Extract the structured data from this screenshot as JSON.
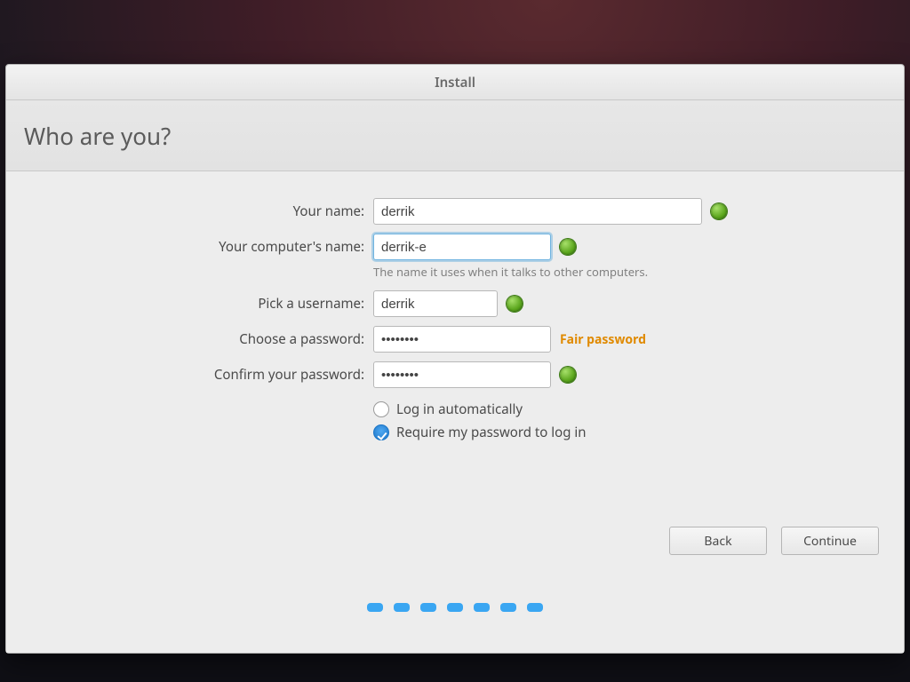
{
  "window": {
    "title": "Install"
  },
  "page": {
    "heading": "Who are you?"
  },
  "labels": {
    "your_name": "Your name:",
    "computer_name": "Your computer's name:",
    "computer_hint": "The name it uses when it talks to other computers.",
    "username": "Pick a username:",
    "password": "Choose a password:",
    "confirm": "Confirm your password:"
  },
  "fields": {
    "your_name": "derrik",
    "computer_name": "derrik-e",
    "username": "derrik",
    "password": "••••••••",
    "confirm": "••••••••",
    "strength": "Fair password"
  },
  "login_options": {
    "auto": "Log in automatically",
    "require": "Require my password to log in",
    "selected": "require"
  },
  "buttons": {
    "back": "Back",
    "continue": "Continue"
  },
  "progress": {
    "total": 7
  }
}
